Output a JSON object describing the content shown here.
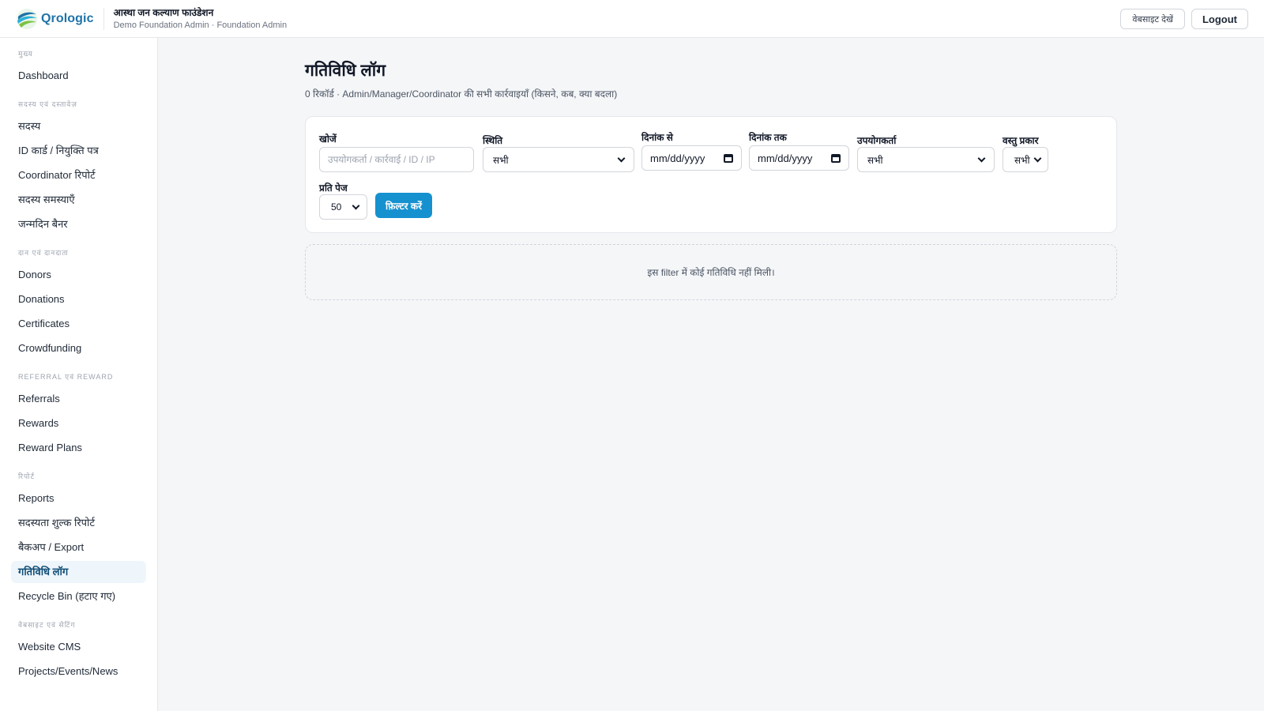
{
  "header": {
    "brand_name": "Qrologic",
    "org_name": "आस्था जन कल्याण फाउंडेशन",
    "org_sub": "Demo Foundation Admin · Foundation Admin",
    "website_button": "वेबसाइट देखें",
    "logout_button": "Logout"
  },
  "sidebar": {
    "sections": [
      {
        "title": "मुख्य",
        "items": [
          {
            "label": "Dashboard"
          }
        ]
      },
      {
        "title": "सदस्य एवं दस्तावेज़",
        "items": [
          {
            "label": "सदस्य"
          },
          {
            "label": "ID कार्ड / नियुक्ति पत्र"
          },
          {
            "label": "Coordinator रिपोर्ट"
          },
          {
            "label": "सदस्य समस्याएँ"
          },
          {
            "label": "जन्मदिन बैनर"
          }
        ]
      },
      {
        "title": "दान एवं दानदाता",
        "items": [
          {
            "label": "Donors"
          },
          {
            "label": "Donations"
          },
          {
            "label": "Certificates"
          },
          {
            "label": "Crowdfunding"
          }
        ]
      },
      {
        "title": "Referral एवं Reward",
        "items": [
          {
            "label": "Referrals"
          },
          {
            "label": "Rewards"
          },
          {
            "label": "Reward Plans"
          }
        ]
      },
      {
        "title": "रिपोर्ट",
        "items": [
          {
            "label": "Reports"
          },
          {
            "label": "सदस्यता शुल्क रिपोर्ट"
          },
          {
            "label": "बैकअप / Export"
          },
          {
            "label": "गतिविधि लॉग",
            "active": true
          },
          {
            "label": "Recycle Bin (हटाए गए)"
          }
        ]
      },
      {
        "title": "वेबसाइट एवं सेटिंग",
        "items": [
          {
            "label": "Website CMS"
          },
          {
            "label": "Projects/Events/News"
          }
        ]
      }
    ]
  },
  "main": {
    "title": "गतिविधि लॉग",
    "subtitle": "0 रिकॉर्ड · Admin/Manager/Coordinator की सभी कार्रवाइयाँ (किसने, कब, क्या बदला)",
    "filters": {
      "search_label": "खोजें",
      "search_placeholder": "उपयोगकर्ता / कार्रवाई / ID / IP",
      "status_label": "स्थिति",
      "status_value": "सभी",
      "date_from_label": "दिनांक से",
      "date_from_value": "mm/dd/yyyy",
      "date_to_label": "दिनांक तक",
      "date_to_value": "mm/dd/yyyy",
      "user_label": "उपयोगकर्ता",
      "user_value": "सभी",
      "object_type_label": "वस्तु प्रकार",
      "object_type_value": "सभी",
      "per_page_label": "प्रति पेज",
      "per_page_value": "50",
      "filter_button": "फ़िल्टर करें"
    },
    "empty_message": "इस filter में कोई गतिविधि नहीं मिली।"
  },
  "colors": {
    "accent": "#1591cf",
    "brand": "#1e73a8",
    "active_bg": "#eef6fb"
  }
}
